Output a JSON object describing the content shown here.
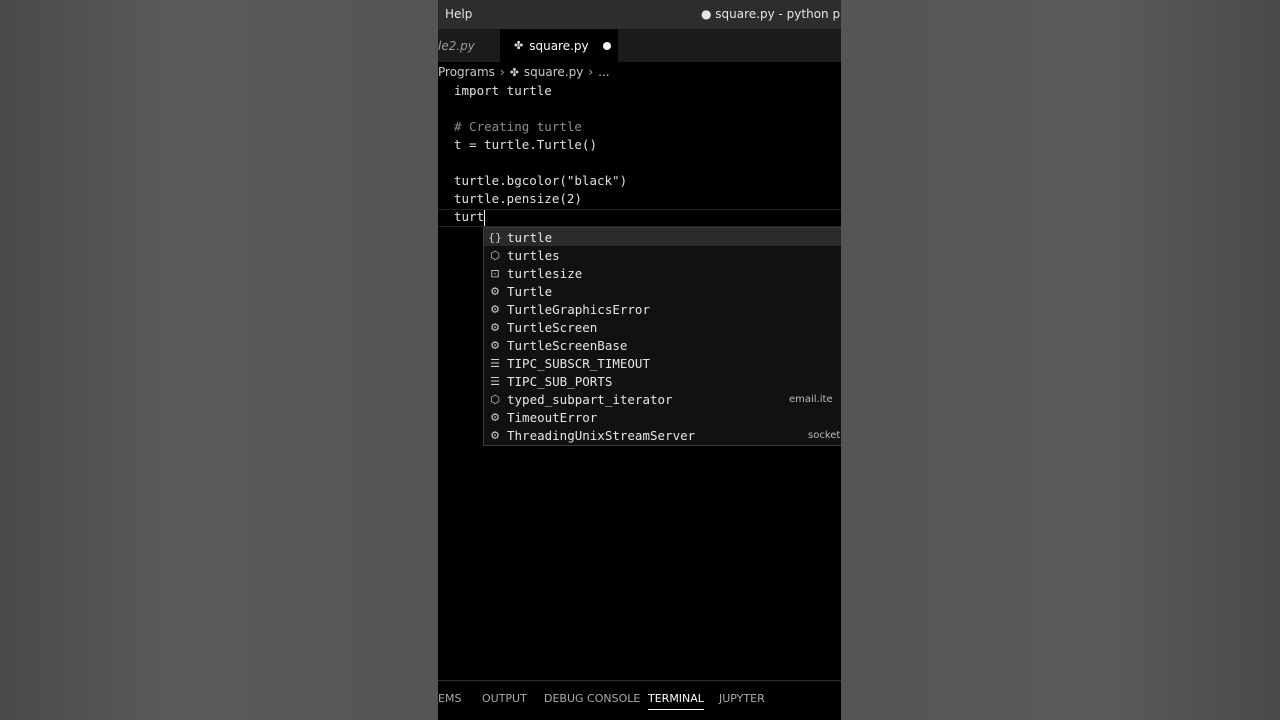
{
  "titlebar": {
    "menu_help": "Help",
    "window_title": "● square.py - python progra"
  },
  "tabs": [
    {
      "label": "le2.py",
      "active": false
    },
    {
      "label": "square.py",
      "active": true,
      "modified_indicator": "●"
    }
  ],
  "breadcrumb": {
    "items": [
      "Programs",
      "square.py",
      "..."
    ],
    "separator": "›"
  },
  "editor": {
    "lines": [
      "import turtle",
      "",
      "# Creating turtle",
      "t = turtle.Turtle()",
      "",
      "turtle.bgcolor(\"black\")",
      "turtle.pensize(2)",
      "turt"
    ]
  },
  "suggestions": [
    {
      "icon": "module-braces-icon",
      "glyph": "{}",
      "label": "turtle",
      "detail": ""
    },
    {
      "icon": "cube-icon",
      "glyph": "⬡",
      "label": "turtles",
      "detail": ""
    },
    {
      "icon": "variable-icon",
      "glyph": "⊡",
      "label": "turtlesize",
      "detail": ""
    },
    {
      "icon": "class-icon",
      "glyph": "⚙",
      "label": "Turtle",
      "detail": ""
    },
    {
      "icon": "class-icon",
      "glyph": "⚙",
      "label": "TurtleGraphicsError",
      "detail": ""
    },
    {
      "icon": "class-icon",
      "glyph": "⚙",
      "label": "TurtleScreen",
      "detail": ""
    },
    {
      "icon": "class-icon",
      "glyph": "⚙",
      "label": "TurtleScreenBase",
      "detail": ""
    },
    {
      "icon": "constant-icon",
      "glyph": "☰",
      "label": "TIPC_SUBSCR_TIMEOUT",
      "detail": ""
    },
    {
      "icon": "constant-icon",
      "glyph": "☰",
      "label": "TIPC_SUB_PORTS",
      "detail": ""
    },
    {
      "icon": "cube-icon",
      "glyph": "⬡",
      "label": "typed_subpart_iterator",
      "detail": "email.ite"
    },
    {
      "icon": "class-icon",
      "glyph": "⚙",
      "label": "TimeoutError",
      "detail": ""
    },
    {
      "icon": "class-icon",
      "glyph": "⚙",
      "label": "ThreadingUnixStreamServer",
      "detail": "socket"
    }
  ],
  "panel_tabs": [
    {
      "label": "EMS",
      "active": false
    },
    {
      "label": "OUTPUT",
      "active": false
    },
    {
      "label": "DEBUG CONSOLE",
      "active": false
    },
    {
      "label": "TERMINAL",
      "active": true
    },
    {
      "label": "JUPYTER",
      "active": false
    }
  ]
}
